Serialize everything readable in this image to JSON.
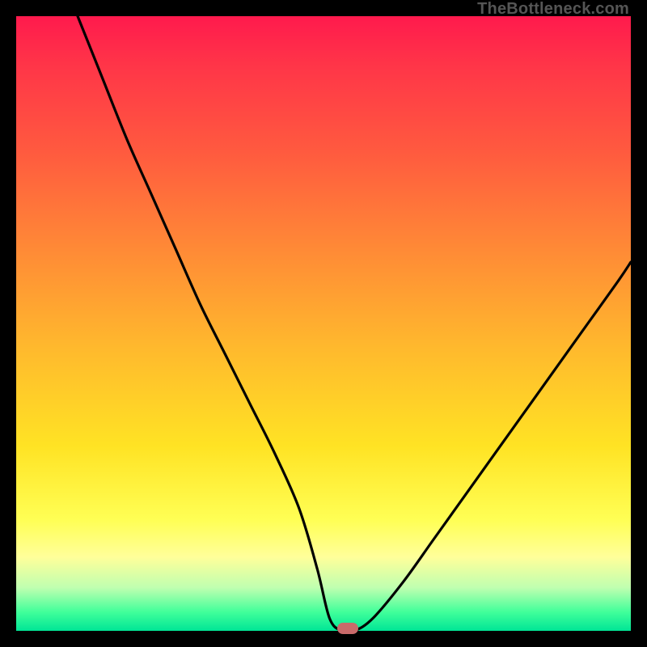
{
  "watermark": "TheBottleneck.com",
  "colors": {
    "frame": "#000000",
    "gradient_top": "#ff1a4d",
    "gradient_bottom": "#00e596",
    "curve": "#000000",
    "marker": "#c96a6a"
  },
  "chart_data": {
    "type": "line",
    "title": "",
    "xlabel": "",
    "ylabel": "",
    "xlim": [
      0,
      100
    ],
    "ylim": [
      0,
      100
    ],
    "grid": false,
    "legend": false,
    "series": [
      {
        "name": "bottleneck-curve",
        "x": [
          10,
          14,
          18,
          22,
          26,
          30,
          34,
          38,
          42,
          46,
          49,
          51,
          53,
          55,
          58,
          63,
          68,
          73,
          78,
          83,
          88,
          93,
          98,
          100
        ],
        "values": [
          100,
          90,
          80,
          71,
          62,
          53,
          45,
          37,
          29,
          20,
          10,
          2,
          0,
          0,
          2,
          8,
          15,
          22,
          29,
          36,
          43,
          50,
          57,
          60
        ]
      }
    ],
    "marker": {
      "x": 54,
      "y": 0
    },
    "background_gradient": {
      "orientation": "vertical",
      "stops": [
        {
          "pos": 0.0,
          "color": "#ff1a4d"
        },
        {
          "pos": 0.22,
          "color": "#ff5a3f"
        },
        {
          "pos": 0.54,
          "color": "#ffb92d"
        },
        {
          "pos": 0.82,
          "color": "#ffff55"
        },
        {
          "pos": 0.97,
          "color": "#3fff9a"
        },
        {
          "pos": 1.0,
          "color": "#00e596"
        }
      ]
    }
  }
}
